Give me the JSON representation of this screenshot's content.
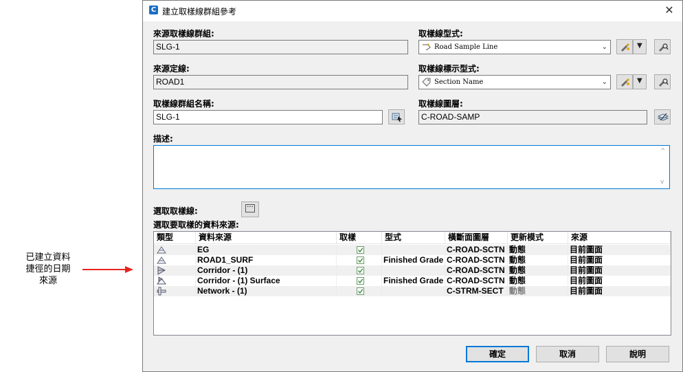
{
  "callout": {
    "line1": "已建立資料",
    "line2": "捷徑的日期",
    "line3": "來源"
  },
  "dialog": {
    "title": "建立取樣線群組參考",
    "close_glyph": "✕"
  },
  "form": {
    "source_group_label": "來源取樣線群組:",
    "source_group_value": "SLG-1",
    "source_alignment_label": "來源定線:",
    "source_alignment_value": "ROAD1",
    "group_name_label": "取樣線群組名稱:",
    "group_name_value": "SLG-1",
    "style_label": "取樣線型式:",
    "style_value": "Road Sample Line",
    "label_style_label": "取樣線標示型式:",
    "label_style_value": "Section Name",
    "layer_label": "取樣線圖層:",
    "layer_value": "C-ROAD-SAMP",
    "description_label": "描述:",
    "description_value": "",
    "select_sample_lines_label": "選取取樣線:",
    "select_sources_label": "選取要取樣的資料來源:"
  },
  "grid": {
    "columns": [
      "類型",
      "資料來源",
      "取樣",
      "型式",
      "橫斷面圖層",
      "更新模式",
      "來源"
    ],
    "rows": [
      {
        "icon": "surface-icon",
        "source": "EG",
        "sample": true,
        "style": "",
        "layer": "C-ROAD-SCTN",
        "update": "動態",
        "origin": "目前圖面"
      },
      {
        "icon": "surface-icon",
        "source": "ROAD1_SURF",
        "sample": true,
        "style": "Finished Grade",
        "layer": "C-ROAD-SCTN",
        "update": "動態",
        "origin": "目前圖面"
      },
      {
        "icon": "corridor-icon",
        "source": "Corridor - (1)",
        "sample": true,
        "style": "",
        "layer": "C-ROAD-SCTN",
        "update": "動態",
        "origin": "目前圖面"
      },
      {
        "icon": "corridor-surface-icon",
        "source": "Corridor - (1) Surface",
        "sample": true,
        "style": "Finished Grade",
        "layer": "C-ROAD-SCTN",
        "update": "動態",
        "origin": "目前圖面"
      },
      {
        "icon": "pipe-network-icon",
        "source": "Network - (1)",
        "sample": true,
        "style": "",
        "layer": "C-STRM-SECT",
        "update": "動態",
        "origin": "目前圖面"
      }
    ]
  },
  "buttons": {
    "ok": "確定",
    "cancel": "取消",
    "help": "說明"
  },
  "colors": {
    "accent": "#0078d7",
    "arrow": "#e8231e"
  }
}
